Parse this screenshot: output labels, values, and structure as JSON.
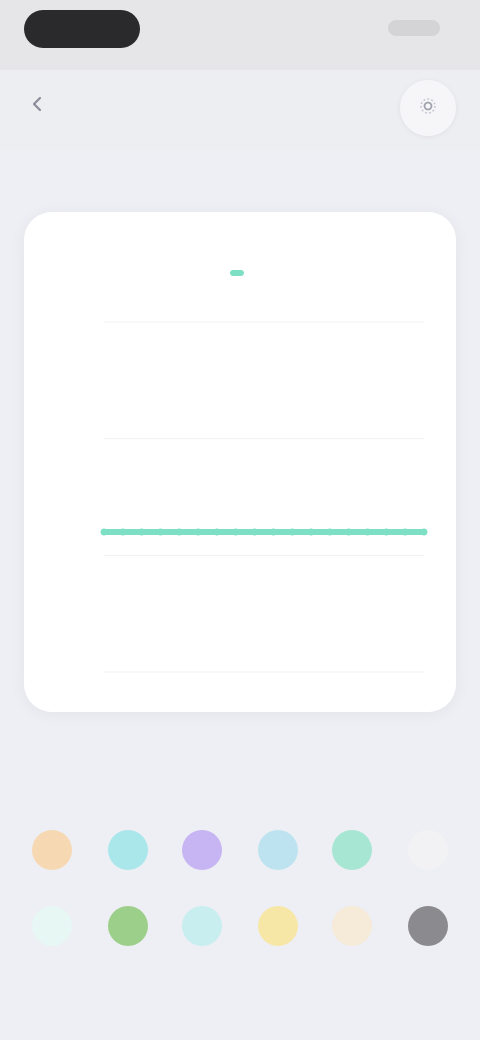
{
  "status": {
    "time": "",
    "battery": ""
  },
  "nav": {
    "back_label": "",
    "title": "",
    "right_icon": "gear-icon"
  },
  "chart_data": {
    "type": "line",
    "title": "",
    "series": [
      {
        "name": "",
        "color": "#7ddfc3",
        "values": [
          1.2,
          1.2,
          1.2,
          1.2,
          1.2,
          1.2,
          1.2,
          1.2,
          1.2,
          1.2,
          1.2,
          1.2,
          1.2,
          1.2,
          1.2,
          1.2,
          1.2,
          1.2
        ]
      }
    ],
    "xlim": [
      0,
      17
    ],
    "ylim": [
      0,
      3
    ],
    "grid": true,
    "legend": "top-center"
  },
  "hint_text": "",
  "palette": [
    {
      "color": "#f6d8b2",
      "label": ""
    },
    {
      "color": "#a9e7eb",
      "label": ""
    },
    {
      "color": "#c7b4f2",
      "label": ""
    },
    {
      "color": "#bde3f0",
      "label": ""
    },
    {
      "color": "#a7e6d2",
      "label": ""
    },
    {
      "color": "#f2f2f4",
      "label": ""
    },
    {
      "color": "#e6f7f4",
      "label": ""
    },
    {
      "color": "#9ccf8a",
      "label": ""
    },
    {
      "color": "#c8eef0",
      "label": ""
    },
    {
      "color": "#f6e7a6",
      "label": ""
    },
    {
      "color": "#f6ead9",
      "label": ""
    },
    {
      "color": "#8a8a8f",
      "label": ""
    }
  ]
}
